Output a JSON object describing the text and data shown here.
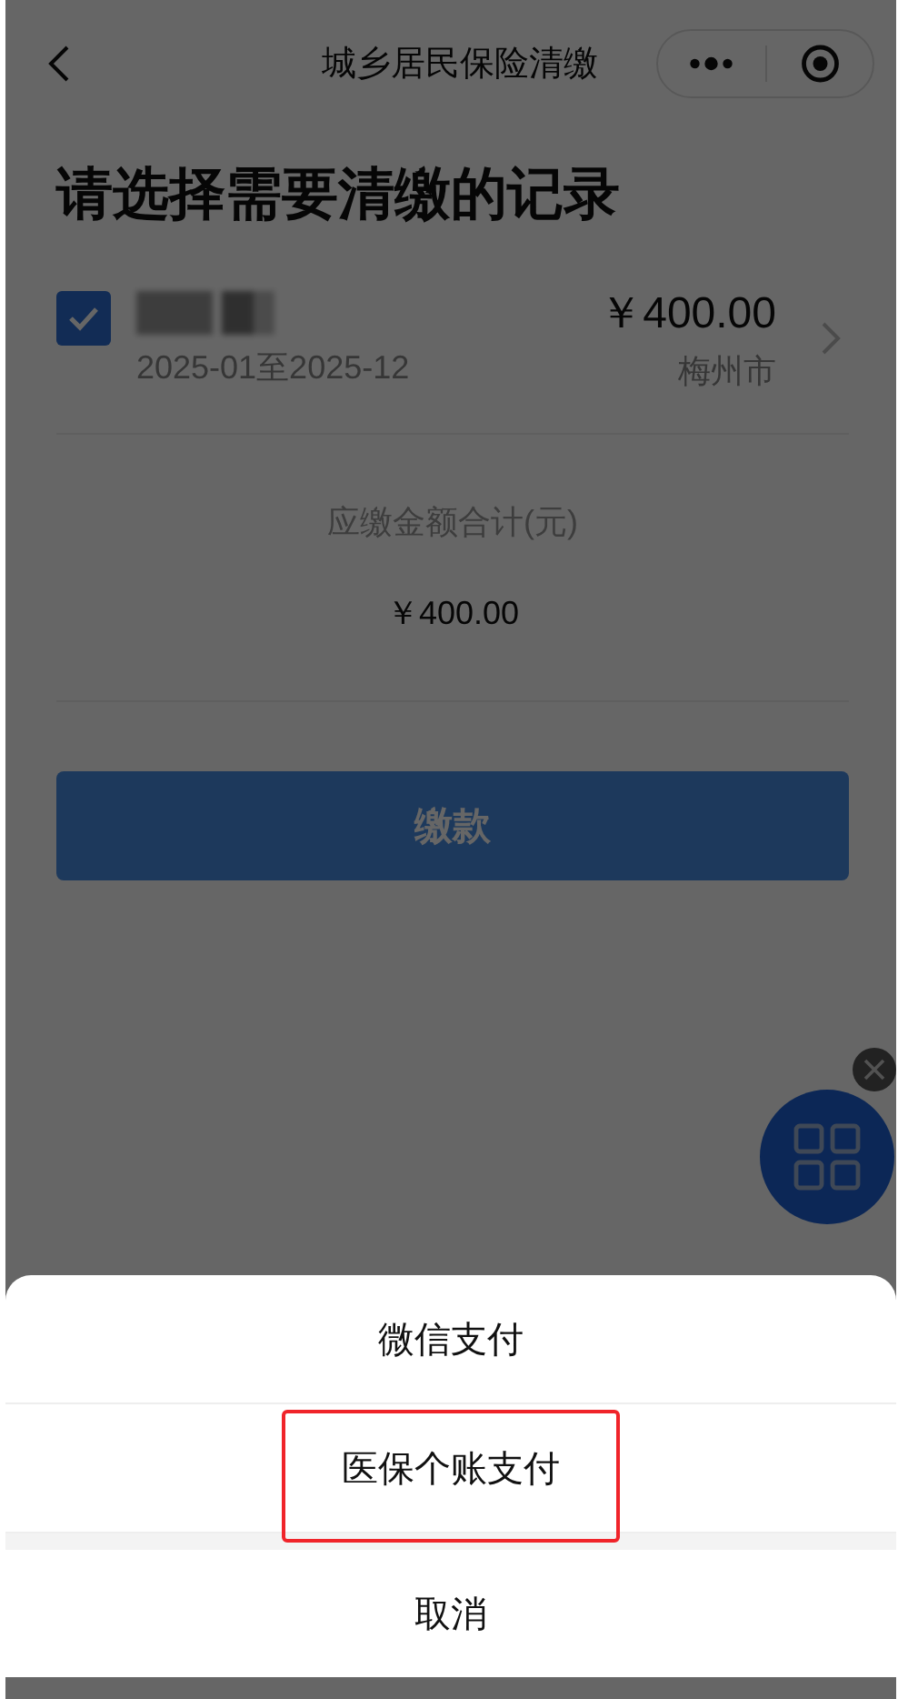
{
  "nav": {
    "title": "城乡居民保险清缴"
  },
  "heading": "请选择需要清缴的记录",
  "records": [
    {
      "checked": true,
      "amount": "￥400.00",
      "period": "2025-01至2025-12",
      "city": "梅州市"
    }
  ],
  "total": {
    "label": "应缴金额合计(元)",
    "amount": "￥400.00"
  },
  "pay_button": "缴款",
  "float_button": {
    "closable": true
  },
  "dimmed": true,
  "action_sheet": {
    "options": [
      {
        "label": "微信支付",
        "highlighted": false
      },
      {
        "label": "医保个账支付",
        "highlighted": true
      }
    ],
    "cancel": "取消"
  }
}
